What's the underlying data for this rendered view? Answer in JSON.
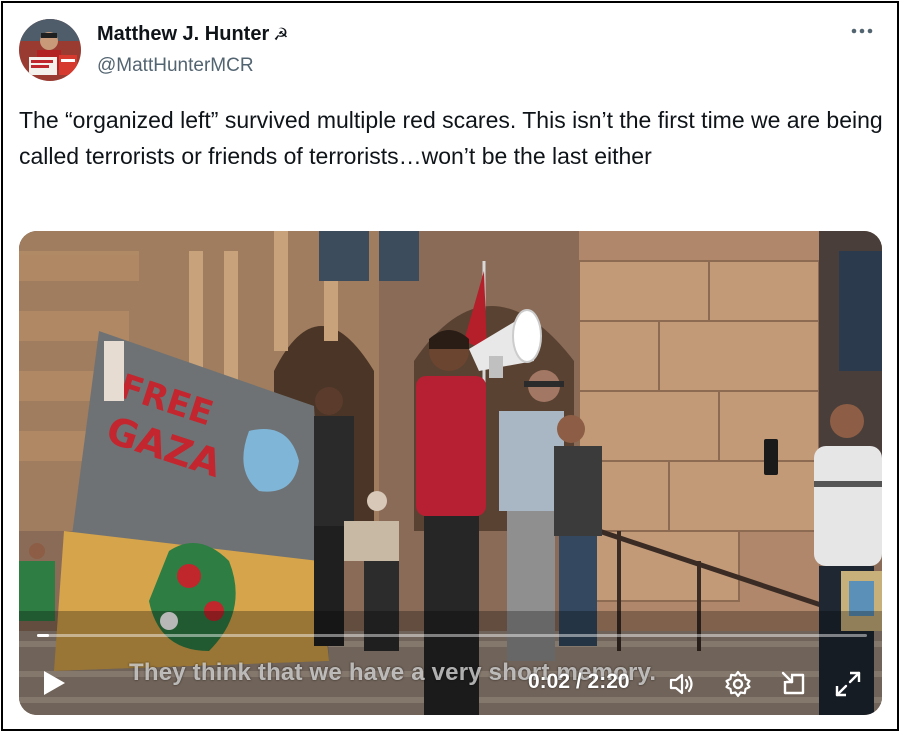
{
  "tweet": {
    "author_name": "Matthew J. Hunter",
    "name_emoji": "☭",
    "handle": "@MattHunterMCR",
    "more_icon": "more-horizontal-icon",
    "text": "The “organized left” survived multiple red scares. This isn’t the first time we are being called terrorists or friends of terrorists…won’t be the last either"
  },
  "video": {
    "caption": "They think that we have a very short memory.",
    "banner_text": "FREE GAZA",
    "current_time": "0:02",
    "duration": "2:20",
    "time_display": "0:02 / 2:20",
    "progress_fraction": 0.014,
    "controls": {
      "play_icon": "play-icon",
      "volume_icon": "volume-icon",
      "settings_icon": "gear-icon",
      "pip_icon": "picture-in-picture-icon",
      "fullscreen_icon": "fullscreen-icon"
    }
  },
  "colors": {
    "text": "#0f1419",
    "secondary_text": "#536471",
    "border": "#000000"
  }
}
